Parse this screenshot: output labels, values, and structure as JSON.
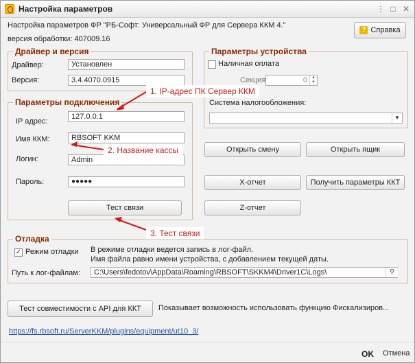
{
  "window": {
    "title": "Настройка параметров",
    "header_line": "Настройка параметров ФР \"РБ-Софт: Универсальный ФР для Сервера ККМ 4.\"",
    "version_line": "версия обработки: 407009.16",
    "help_label": "Справка"
  },
  "driver": {
    "group_title": "Драйвер и версия",
    "driver_label": "Драйвер:",
    "driver_value": "Установлен",
    "version_label": "Версия:",
    "version_value": "3.4.4070.0915"
  },
  "connection": {
    "group_title": "Параметры подключения",
    "ip_label": "IP адрес:",
    "ip_value": "127.0.0.1",
    "kkm_label": "Имя ККМ:",
    "kkm_value": "RBSOFT KKM",
    "login_label": "Логин:",
    "login_value": "Admin",
    "password_label": "Пароль:",
    "password_value": "●●●●●",
    "test_button": "Тест связи"
  },
  "device": {
    "group_title": "Параметры устройства",
    "cash_label": "Наличная оплата",
    "section_label": "Секция:",
    "section_value": "0",
    "tax_label": "Система налогообложения:",
    "tax_value": "",
    "buttons": {
      "open_shift": "Открыть смену",
      "open_drawer": "Открыть ящик",
      "x_report": "Х-отчет",
      "get_params": "Получить параметры ККТ",
      "z_report": "Z-отчет"
    }
  },
  "debug": {
    "group_title": "Отладка",
    "mode_label": "Режим отладки",
    "mode_checked": true,
    "info_line1": "В режиме отладки ведется запись в лог-файл.",
    "info_line2": "Имя файла равно имени устройства, с добавлением текущей даты.",
    "path_label": "Путь к лог-файлам:",
    "path_value": "C:\\Users\\fedotov\\AppData\\Roaming\\RBSOFT\\SKKM4\\Driver1C\\Logs\\"
  },
  "api": {
    "button": "Тест совместимости с API для ККТ",
    "description": "Показывает возможность использовать функцию Фискализиров..."
  },
  "footer": {
    "link": "https://fs.rbsoft.ru/ServerKKM/plugins/equipment/ut10_3/",
    "ok": "OK",
    "cancel": "Отмена"
  },
  "annotations": {
    "a1": "1. IP-адрес ПК Сервер ККМ",
    "a2": "2. Название кассы",
    "a3": "3. Тест связи",
    "color": "#d01818"
  },
  "icons": {
    "help": "question-icon",
    "search": "magnifier-icon",
    "checkbox": "check-icon"
  }
}
